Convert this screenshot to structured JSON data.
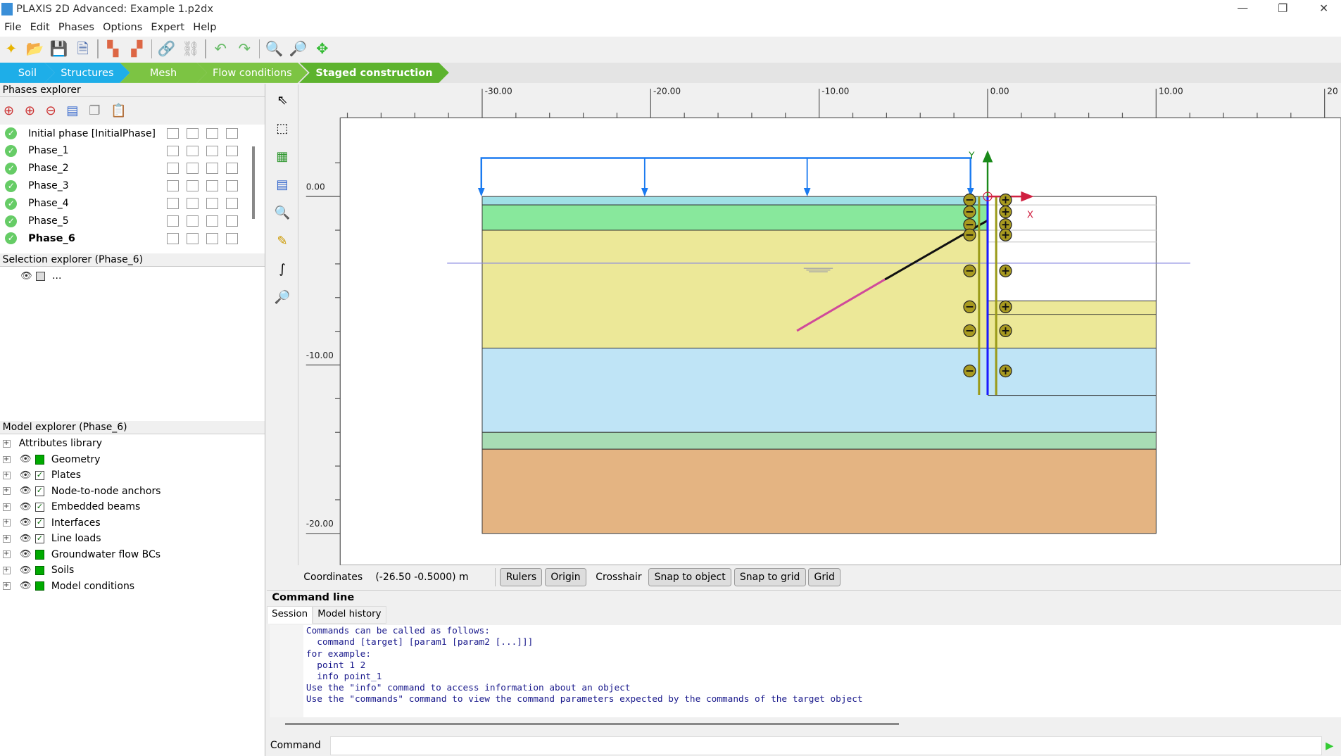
{
  "window": {
    "title": "PLAXIS 2D Advanced: Example 1.p2dx",
    "minimize": "—",
    "restore": "❐",
    "close": "✕"
  },
  "menu": [
    "File",
    "Edit",
    "Phases",
    "Options",
    "Expert",
    "Help"
  ],
  "toolbar_icons": [
    "new-project-icon",
    "open-project-icon",
    "save-icon",
    "project-properties-icon",
    "import-icon",
    "export-icon",
    "link-icon",
    "unlink-icon",
    "undo-icon",
    "redo-icon",
    "zoom-in-icon",
    "zoom-window-icon",
    "pan-icon"
  ],
  "workflow": [
    {
      "label": "Soil",
      "color": "#1eaee8"
    },
    {
      "label": "Structures",
      "color": "#1eaee8"
    },
    {
      "label": "Mesh",
      "color": "#7cc443"
    },
    {
      "label": "Flow conditions",
      "color": "#7cc443"
    },
    {
      "label": "Staged construction",
      "color": "#5db32e",
      "active": true
    }
  ],
  "phases_explorer": {
    "title": "Phases explorer",
    "phases": [
      "Initial phase [InitialPhase]",
      "Phase_1",
      "Phase_2",
      "Phase_3",
      "Phase_4",
      "Phase_5",
      "Phase_6"
    ],
    "selected": "Phase_6"
  },
  "selection_explorer": {
    "title": "Selection explorer (Phase_6)",
    "item": "..."
  },
  "model_explorer": {
    "title": "Model explorer (Phase_6)",
    "items": [
      {
        "label": "Attributes library",
        "state": "none"
      },
      {
        "label": "Geometry",
        "state": "partial"
      },
      {
        "label": "Plates",
        "state": "checked"
      },
      {
        "label": "Node-to-node anchors",
        "state": "checked"
      },
      {
        "label": "Embedded beams",
        "state": "checked"
      },
      {
        "label": "Interfaces",
        "state": "checked"
      },
      {
        "label": "Line loads",
        "state": "checked"
      },
      {
        "label": "Groundwater flow BCs",
        "state": "partial"
      },
      {
        "label": "Soils",
        "state": "partial"
      },
      {
        "label": "Model conditions",
        "state": "partial"
      }
    ]
  },
  "rulers": {
    "x": [
      "-30.00",
      "-20.00",
      "-10.00",
      "0.00",
      "10.00",
      "20"
    ],
    "y": [
      "0.00",
      "-10.00",
      "-20.00"
    ]
  },
  "canvas": {
    "axis_x": "X",
    "axis_y": "Y",
    "colors": {
      "top": "#9fe0e6",
      "clay1": "#88e89c",
      "sand": "#ece898",
      "gravel": "#bfe4f6",
      "thin": "#a8dcb4",
      "deep": "#e4b482"
    }
  },
  "status": {
    "coord_label": "Coordinates",
    "coord_value": "(-26.50 -0.5000) m",
    "buttons": [
      "Rulers",
      "Origin",
      "Crosshair",
      "Snap to object",
      "Snap to grid",
      "Grid"
    ]
  },
  "command_line": {
    "title": "Command line",
    "tabs": [
      "Session",
      "Model history"
    ],
    "text": "Commands can be called as follows:\n  command [target] [param1 [param2 [...]]]\nfor example:\n  point 1 2\n  info point_1\nUse the \"info\" command to access information about an object\nUse the \"commands\" command to view the command parameters expected by the commands of the target object",
    "input_label": "Command",
    "input_value": ""
  }
}
